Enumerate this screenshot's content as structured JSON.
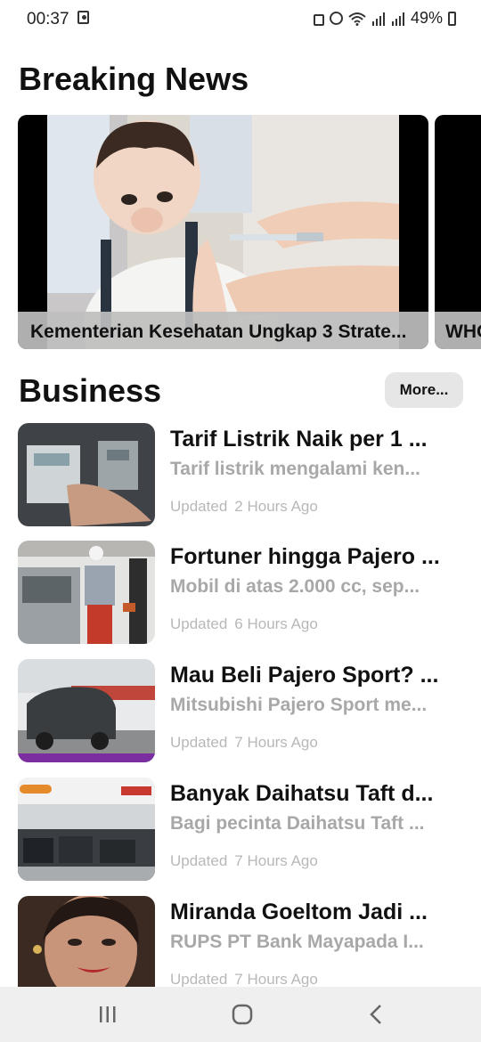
{
  "status_bar": {
    "time": "00:37",
    "battery": "49%"
  },
  "breaking": {
    "title": "Breaking News",
    "cards": [
      {
        "caption": "Kementerian Kesehatan Ungkap 3 Strate..."
      },
      {
        "caption": "WHO"
      }
    ]
  },
  "business": {
    "title": "Business",
    "more_label": "More...",
    "items": [
      {
        "title": "Tarif Listrik Naik per 1 ...",
        "desc": "Tarif listrik mengalami ken...",
        "updated_label": "Updated",
        "time": "2 Hours Ago"
      },
      {
        "title": "Fortuner hingga Pajero ...",
        "desc": "Mobil di atas 2.000 cc, sep...",
        "updated_label": "Updated",
        "time": "6 Hours Ago"
      },
      {
        "title": "Mau Beli Pajero Sport? ...",
        "desc": "Mitsubishi Pajero Sport me...",
        "updated_label": "Updated",
        "time": "7 Hours Ago"
      },
      {
        "title": "Banyak Daihatsu Taft d...",
        "desc": "Bagi pecinta Daihatsu Taft ...",
        "updated_label": "Updated",
        "time": "7 Hours Ago"
      },
      {
        "title": "Miranda Goeltom Jadi ...",
        "desc": "RUPS PT Bank Mayapada I...",
        "updated_label": "Updated",
        "time": "7 Hours Ago"
      }
    ]
  }
}
